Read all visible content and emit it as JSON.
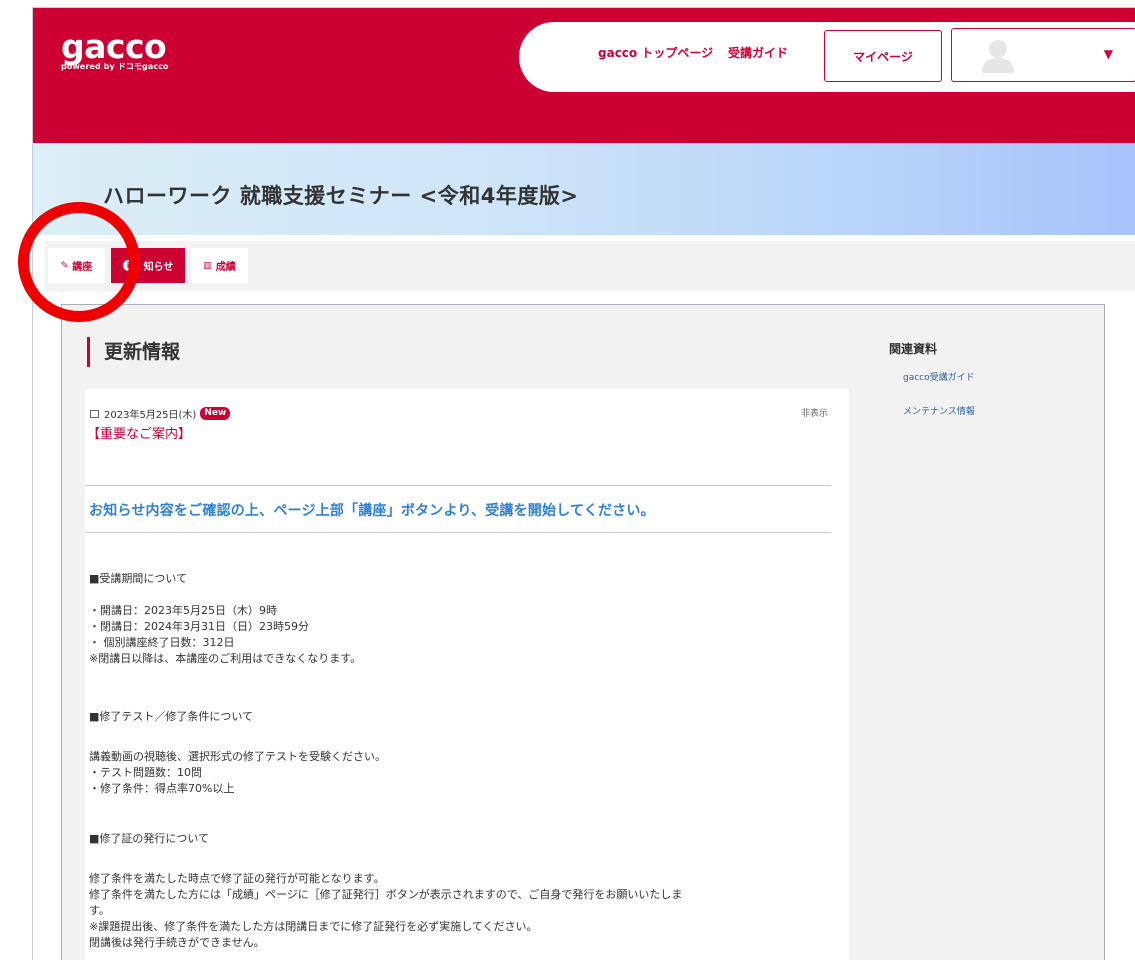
{
  "header": {
    "logo_main": "gacco",
    "logo_sub": "powered by ドコモgacco",
    "nav": {
      "top_page": "gacco トップページ",
      "guide": "受講ガイド",
      "mypage": "マイページ"
    },
    "user_menu_caret": "▼"
  },
  "course": {
    "title": "ハローワーク 就職支援セミナー <令和4年度版>"
  },
  "tabs": [
    {
      "label": "講座",
      "icon": "edit-icon",
      "icon_glyph": "✎"
    },
    {
      "label": "知らせ",
      "icon": "info-icon",
      "icon_glyph": "i"
    },
    {
      "label": "成績",
      "icon": "chart-icon",
      "icon_glyph": "▥"
    }
  ],
  "main": {
    "section_title": "更新情報",
    "post": {
      "date": "2023年5月25日(木)",
      "new_badge": "New",
      "hide_label": "非表示",
      "subject": "【重要なご案内】",
      "headline": "お知らせ内容をご確認の上、ページ上部「講座」ボタンより、受講を開始してください。",
      "lines": [
        "■受講期間について",
        "・開講日：2023年5月25日（木）9時",
        "・閉講日：2024年3月31日（日）23時59分",
        "・ 個別講座終了日数：312日",
        "※閉講日以降は、本講座のご利用はできなくなります。",
        "■修了テスト／修了条件について",
        "講義動画の視聴後、選択形式の修了テストを受験ください。",
        "・テスト問題数：10問",
        "・修了条件：得点率70%以上",
        "■修了証の発行について",
        "修了条件を満たした時点で修了証の発行が可能となります。",
        "修了条件を満たした方には「成績」ページに［修了証発行］ボタンが表示されますので、ご自身で発行をお願いいたしま",
        "す。",
        "※課題提出後、修了条件を満たした方は閉講日までに修了証発行を必ず実施してください。",
        "閉講後は発行手続きができません。"
      ]
    }
  },
  "sidebar": {
    "heading": "関連資料",
    "links": [
      "gacco受講ガイド",
      "メンテナンス情報"
    ]
  },
  "colors": {
    "brand_red": "#cc0033",
    "link_blue": "#2e7fd6",
    "annotation_red": "#ee0000"
  }
}
